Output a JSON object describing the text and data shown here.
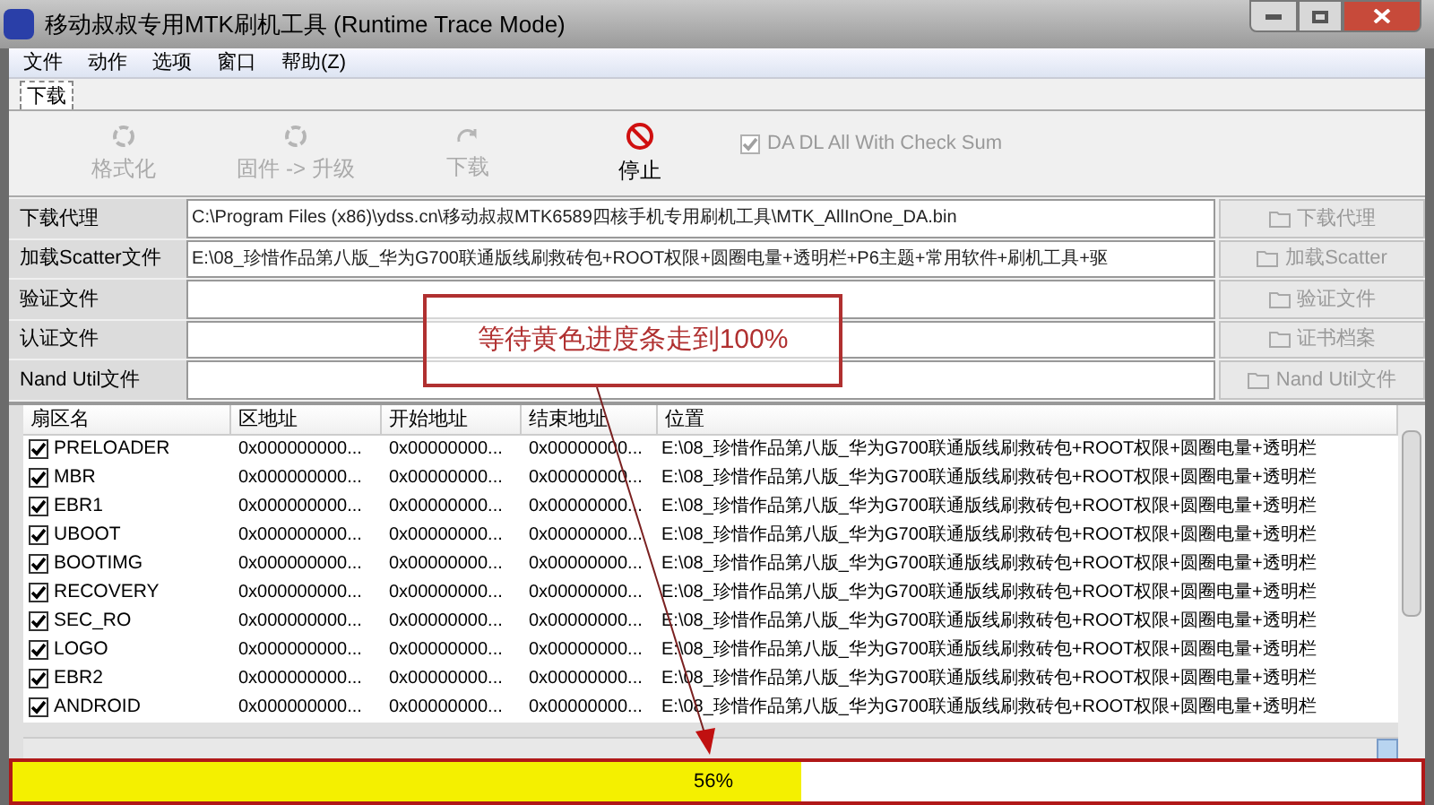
{
  "window": {
    "title": "移动叔叔专用MTK刷机工具 (Runtime Trace Mode)"
  },
  "menu": [
    "文件",
    "动作",
    "选项",
    "窗口",
    "帮助(Z)"
  ],
  "tabs": [
    {
      "label": "下载",
      "selected": true
    }
  ],
  "toolbar": [
    {
      "label": "格式化",
      "kind": "format",
      "disabled": true
    },
    {
      "label": "固件 -> 升级",
      "kind": "format",
      "disabled": true
    },
    {
      "label": "下载",
      "kind": "download",
      "disabled": true
    },
    {
      "label": "停止",
      "kind": "stop",
      "disabled": false
    }
  ],
  "checksum": {
    "label": "DA DL All With Check Sum",
    "checked": true,
    "disabled": true
  },
  "fields": [
    {
      "label": "下载代理",
      "value": "C:\\Program Files (x86)\\ydss.cn\\移动叔叔MTK6589四核手机专用刷机工具\\MTK_AllInOne_DA.bin",
      "button": "下载代理"
    },
    {
      "label": "加载Scatter文件",
      "value": "E:\\08_珍惜作品第八版_华为G700联通版线刷救砖包+ROOT权限+圆圈电量+透明栏+P6主题+常用软件+刷机工具+驱",
      "button": "加载Scatter"
    },
    {
      "label": "验证文件",
      "button": "验证文件"
    },
    {
      "label": "认证文件",
      "button": "证书档案"
    },
    {
      "label": "Nand Util文件",
      "button": "Nand Util文件"
    }
  ],
  "annotation": {
    "text": "等待黄色进度条走到100%"
  },
  "table": {
    "columns": [
      "扇区名",
      "区地址",
      "开始地址",
      "结束地址",
      "位置"
    ],
    "rows": [
      {
        "name": "PRELOADER",
        "checked": true,
        "address": "0x000000000...",
        "start": "0x00000000...",
        "end": "0x00000000...",
        "location": "E:\\08_珍惜作品第八版_华为G700联通版线刷救砖包+ROOT权限+圆圈电量+透明栏"
      },
      {
        "name": "MBR",
        "checked": true,
        "address": "0x000000000...",
        "start": "0x00000000...",
        "end": "0x00000000...",
        "location": "E:\\08_珍惜作品第八版_华为G700联通版线刷救砖包+ROOT权限+圆圈电量+透明栏"
      },
      {
        "name": "EBR1",
        "checked": true,
        "address": "0x000000000...",
        "start": "0x00000000...",
        "end": "0x00000000...",
        "location": "E:\\08_珍惜作品第八版_华为G700联通版线刷救砖包+ROOT权限+圆圈电量+透明栏"
      },
      {
        "name": "UBOOT",
        "checked": true,
        "address": "0x000000000...",
        "start": "0x00000000...",
        "end": "0x00000000...",
        "location": "E:\\08_珍惜作品第八版_华为G700联通版线刷救砖包+ROOT权限+圆圈电量+透明栏"
      },
      {
        "name": "BOOTIMG",
        "checked": true,
        "address": "0x000000000...",
        "start": "0x00000000...",
        "end": "0x00000000...",
        "location": "E:\\08_珍惜作品第八版_华为G700联通版线刷救砖包+ROOT权限+圆圈电量+透明栏"
      },
      {
        "name": "RECOVERY",
        "checked": true,
        "address": "0x000000000...",
        "start": "0x00000000...",
        "end": "0x00000000...",
        "location": "E:\\08_珍惜作品第八版_华为G700联通版线刷救砖包+ROOT权限+圆圈电量+透明栏"
      },
      {
        "name": "SEC_RO",
        "checked": true,
        "address": "0x000000000...",
        "start": "0x00000000...",
        "end": "0x00000000...",
        "location": "E:\\08_珍惜作品第八版_华为G700联通版线刷救砖包+ROOT权限+圆圈电量+透明栏"
      },
      {
        "name": "LOGO",
        "checked": true,
        "address": "0x000000000...",
        "start": "0x00000000...",
        "end": "0x00000000...",
        "location": "E:\\08_珍惜作品第八版_华为G700联通版线刷救砖包+ROOT权限+圆圈电量+透明栏"
      },
      {
        "name": "EBR2",
        "checked": true,
        "address": "0x000000000...",
        "start": "0x00000000...",
        "end": "0x00000000...",
        "location": "E:\\08_珍惜作品第八版_华为G700联通版线刷救砖包+ROOT权限+圆圈电量+透明栏"
      },
      {
        "name": "ANDROID",
        "checked": true,
        "address": "0x000000000...",
        "start": "0x00000000...",
        "end": "0x00000000...",
        "location": "E:\\08_珍惜作品第八版_华为G700联通版线刷救砖包+ROOT权限+圆圈电量+透明栏"
      }
    ]
  },
  "progress": {
    "level": 0.56,
    "reading": "56%"
  }
}
